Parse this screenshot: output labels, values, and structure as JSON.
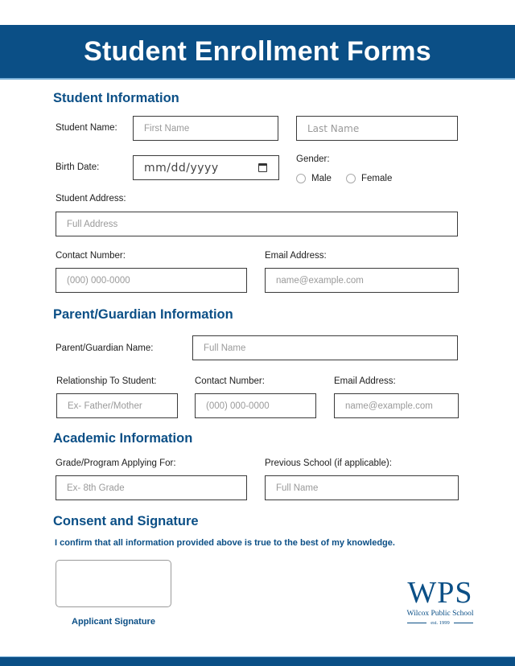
{
  "header": {
    "title": "Student Enrollment Forms"
  },
  "sections": {
    "student": {
      "title": "Student Information",
      "name_label": "Student Name:",
      "first_name_placeholder": "First Name",
      "last_name_placeholder": "Last Name",
      "birth_label": "Birth Date:",
      "birth_placeholder": "mm/dd/yyyy",
      "gender_label": "Gender:",
      "gender_options": [
        "Male",
        "Female"
      ],
      "address_label": "Student Address:",
      "address_placeholder": "Full Address",
      "contact_label": "Contact Number:",
      "contact_placeholder": "(000) 000-0000",
      "email_label": "Email Address:",
      "email_placeholder": "name@example.com"
    },
    "parent": {
      "title": "Parent/Guardian Information",
      "name_label": "Parent/Guardian Name:",
      "name_placeholder": "Full Name",
      "relationship_label": "Relationship To Student:",
      "relationship_placeholder": "Ex- Father/Mother",
      "contact_label": "Contact Number:",
      "contact_placeholder": "(000) 000-0000",
      "email_label": "Email Address:",
      "email_placeholder": "name@example.com"
    },
    "academic": {
      "title": "Academic Information",
      "grade_label": "Grade/Program Applying For:",
      "grade_placeholder": "Ex- 8th Grade",
      "prev_school_label": "Previous School (if applicable):",
      "prev_school_placeholder": "Full Name"
    },
    "consent": {
      "title": "Consent and Signature",
      "statement": "I confirm that all information provided above is true to the best of my knowledge.",
      "signature_label": "Applicant Signature"
    }
  },
  "logo": {
    "monogram": "WPS",
    "school_name": "Wilcox Public School",
    "established": "est. 1999"
  },
  "colors": {
    "brand": "#0b4f86",
    "accent_line": "#7ab0d8"
  }
}
